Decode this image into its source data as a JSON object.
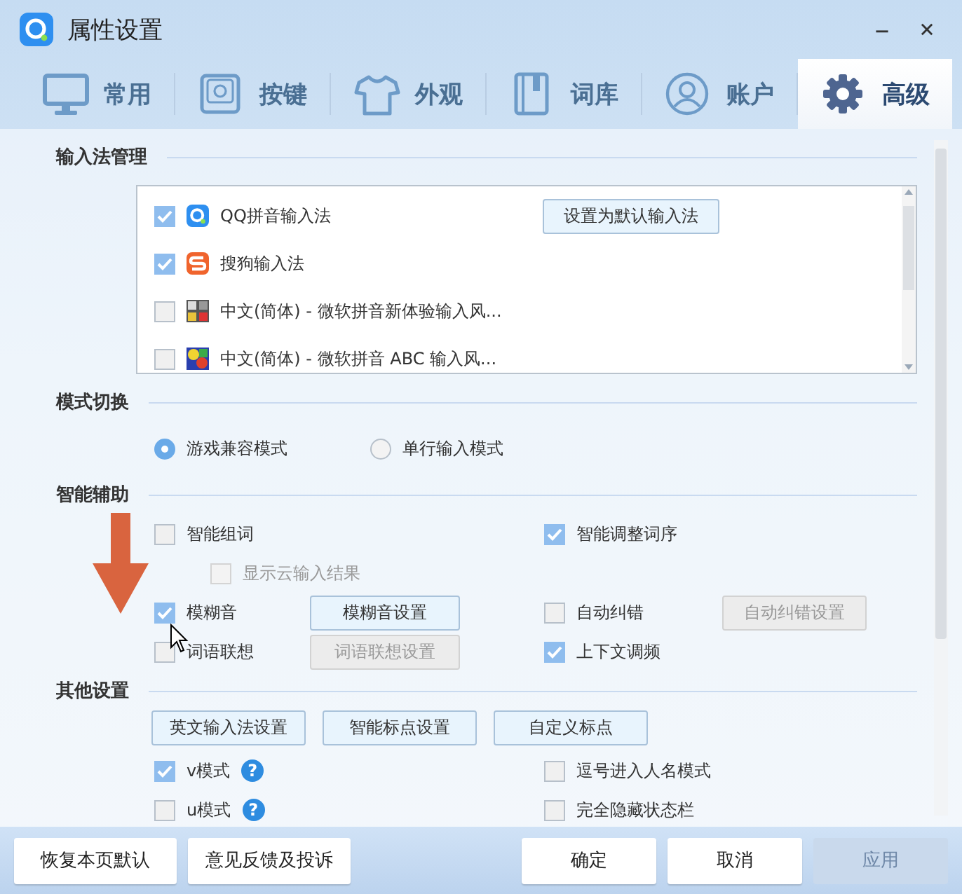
{
  "window": {
    "title": "属性设置"
  },
  "tabs": [
    {
      "label": "常用",
      "selected": false
    },
    {
      "label": "按键",
      "selected": false
    },
    {
      "label": "外观",
      "selected": false
    },
    {
      "label": "词库",
      "selected": false
    },
    {
      "label": "账户",
      "selected": false
    },
    {
      "label": "高级",
      "selected": true
    }
  ],
  "sections": [
    {
      "title": "输入法管理",
      "kind": "ime_list",
      "button": "设置为默认输入法",
      "items": [
        {
          "label": "QQ拼音输入法",
          "checked": true
        },
        {
          "label": "搜狗输入法",
          "checked": true
        },
        {
          "label": "中文(简体) - 微软拼音新体验输入风...",
          "checked": false
        },
        {
          "label": "中文(简体) - 微软拼音 ABC 输入风...",
          "checked": false
        }
      ]
    },
    {
      "title": "模式切换",
      "kind": "radios",
      "options": [
        {
          "label": "游戏兼容模式",
          "selected": true
        },
        {
          "label": "单行输入模式",
          "selected": false
        }
      ]
    },
    {
      "title": "智能辅助",
      "kind": "grid",
      "rows": [
        {
          "left": {
            "label": "智能组词",
            "checked": false,
            "children": [
              {
                "label": "显示云输入结果",
                "checked": false,
                "disabled": true
              }
            ]
          },
          "right": {
            "label": "智能调整词序",
            "checked": true
          }
        },
        {
          "left": {
            "label": "模糊音",
            "checked": true,
            "button": {
              "label": "模糊音设置",
              "disabled": false
            }
          },
          "right": {
            "label": "自动纠错",
            "checked": false,
            "button": {
              "label": "自动纠错设置",
              "disabled": true
            }
          }
        },
        {
          "left": {
            "label": "词语联想",
            "checked": false,
            "button": {
              "label": "词语联想设置",
              "disabled": true
            }
          },
          "right": {
            "label": "上下文调频",
            "checked": true
          }
        }
      ]
    },
    {
      "title": "其他设置",
      "kind": "other",
      "buttons": [
        "英文输入法设置",
        "智能标点设置",
        "自定义标点"
      ],
      "rows": [
        {
          "left": {
            "label": "v模式",
            "checked": true,
            "help": "?"
          },
          "right": {
            "label": "逗号进入人名模式",
            "checked": false
          }
        },
        {
          "left": {
            "label": "u模式",
            "checked": false,
            "help": "?"
          },
          "right": {
            "label": "完全隐藏状态栏",
            "checked": false
          }
        }
      ]
    }
  ],
  "footer": {
    "left_buttons": [
      {
        "label": "恢复本页默认",
        "disabled": false
      },
      {
        "label": "意见反馈及投诉",
        "disabled": false
      }
    ],
    "right_buttons": [
      {
        "label": "确定",
        "disabled": false
      },
      {
        "label": "取消",
        "disabled": false
      },
      {
        "label": "应用",
        "disabled": true
      }
    ]
  }
}
